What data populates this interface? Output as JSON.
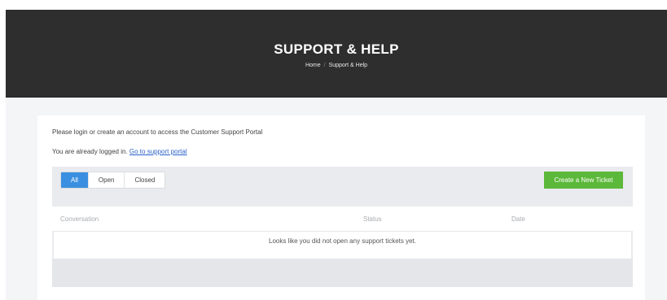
{
  "hero": {
    "title": "SUPPORT & HELP",
    "breadcrumb": {
      "home": "Home",
      "separator": "/",
      "current": "Support & Help"
    }
  },
  "notice": "Please login or create an account to access the Customer Support Portal",
  "logged_in": {
    "text": "You are already logged in.",
    "link": "Go to support portal"
  },
  "tabs": [
    {
      "label": "All",
      "active": true
    },
    {
      "label": "Open",
      "active": false
    },
    {
      "label": "Closed",
      "active": false
    }
  ],
  "create_button": "Create a New Ticket",
  "table": {
    "columns": [
      "Conversation",
      "Status",
      "Date"
    ],
    "empty_message": "Looks like you did not open any support tickets yet."
  },
  "colors": {
    "hero_bg": "#2e2e2e",
    "active_tab": "#3b8fe0",
    "create_button": "#5cb83a",
    "link": "#2a62c9"
  }
}
